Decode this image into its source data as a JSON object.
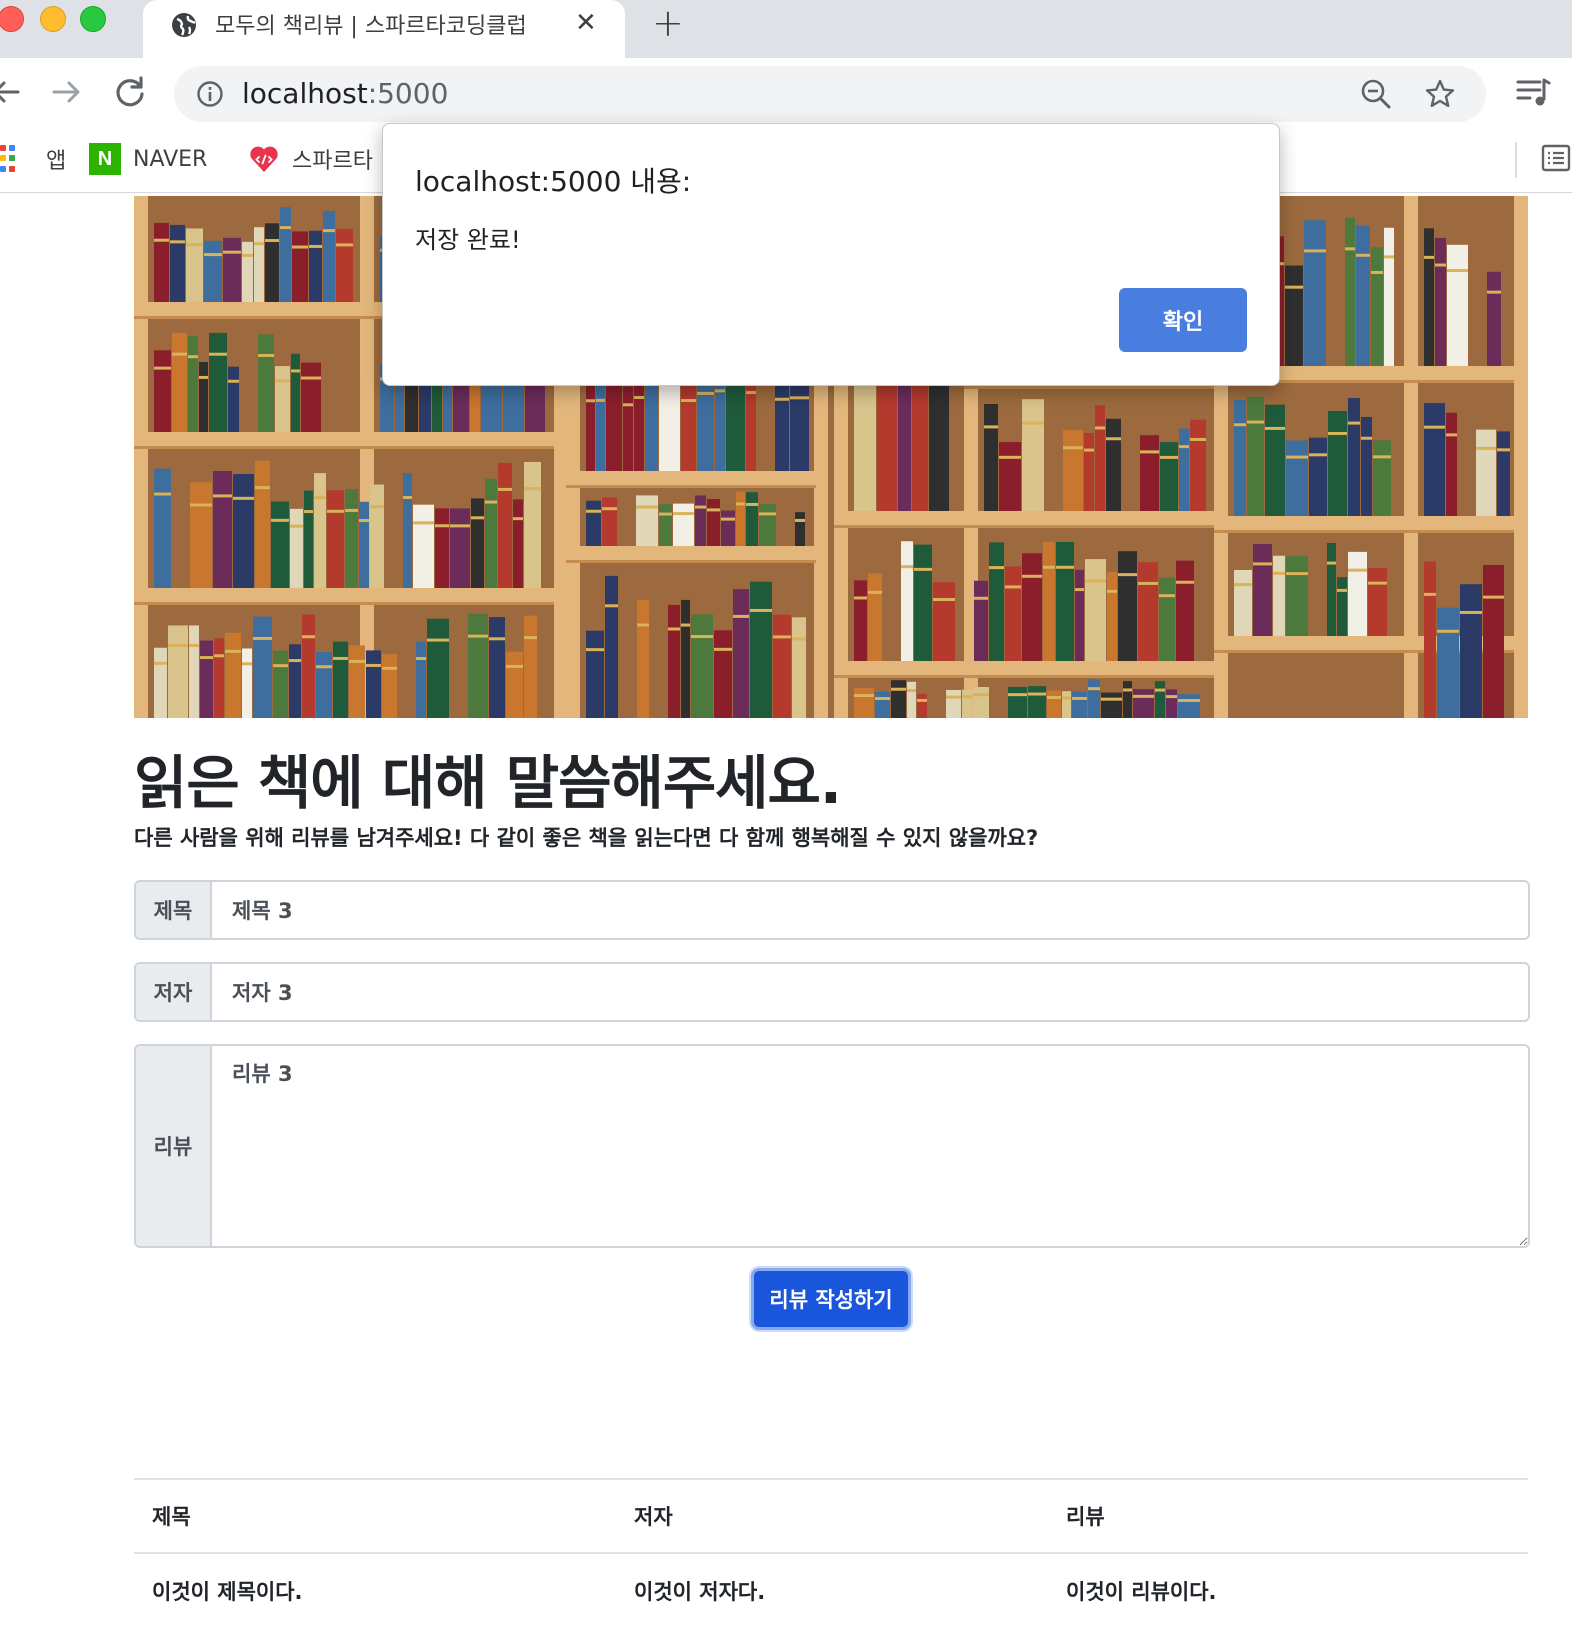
{
  "browser": {
    "tab_title": "모두의 책리뷰 | 스파르타코딩클럽",
    "tab_close": "✕",
    "new_tab": "+",
    "url_host": "localhost",
    "url_port": ":5000",
    "bookmarks": [
      {
        "label": "앱",
        "icon": "apps-grid-icon"
      },
      {
        "label": "NAVER",
        "icon": "naver-icon",
        "icon_text": "N",
        "color": "#2db400"
      },
      {
        "label": "스파르타",
        "icon": "sparta-icon",
        "color": "#e8344e"
      }
    ]
  },
  "page": {
    "heading": "읽은 책에 대해 말씀해주세요.",
    "subheading": "다른 사람을 위해 리뷰를 남겨주세요! 다 같이 좋은 책을 읽는다면 다 함께 행복해질 수 있지 않을까요?",
    "form": {
      "title_label": "제목",
      "title_value": "제목 3",
      "author_label": "저자",
      "author_value": "저자 3",
      "review_label": "리뷰",
      "review_value": "리뷰 3"
    },
    "submit_label": "리뷰 작성하기",
    "table": {
      "headers": [
        "제목",
        "저자",
        "리뷰"
      ],
      "rows": [
        [
          "이것이 제목이다.",
          "이것이 저자다.",
          "이것이 리뷰이다."
        ]
      ]
    }
  },
  "dialog": {
    "title": "localhost:5000 내용:",
    "message": "저장 완료!",
    "ok_label": "확인"
  },
  "colors": {
    "primary_button": "#1a56db",
    "dialog_button": "#4a7de0",
    "tabstrip": "#dee1e6"
  }
}
